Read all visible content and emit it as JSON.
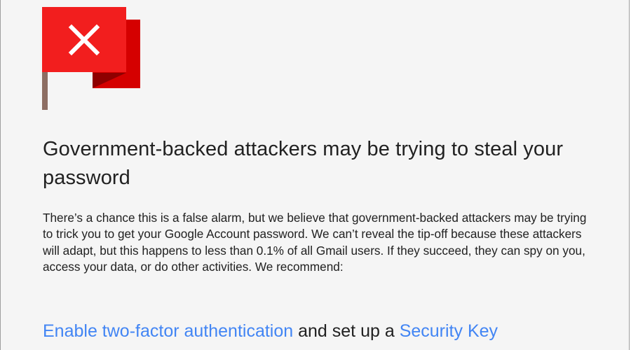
{
  "alert": {
    "icon": "red-flag-with-x-icon",
    "colors": {
      "flag_red": "#f21e1e",
      "flag_back": "#d50000",
      "pole": "#8d6e63",
      "link": "#4285f4",
      "text": "#212121",
      "background": "#f5f5f5"
    },
    "title": "Government-backed attackers may be trying to steal your password",
    "body": "There’s a chance this is a false alarm, but we believe that government-backed attackers may be trying to trick you to get your Google Account password. We can’t reveal the tip-off because these attackers will adapt, but this happens to less than 0.1% of all Gmail users. If they succeed, they can spy on you, access your data, or do other activities. We recommend:",
    "recommendation": {
      "link1": "Enable two-factor authentication",
      "middle": " and set up a ",
      "link2": "Security Key"
    }
  }
}
